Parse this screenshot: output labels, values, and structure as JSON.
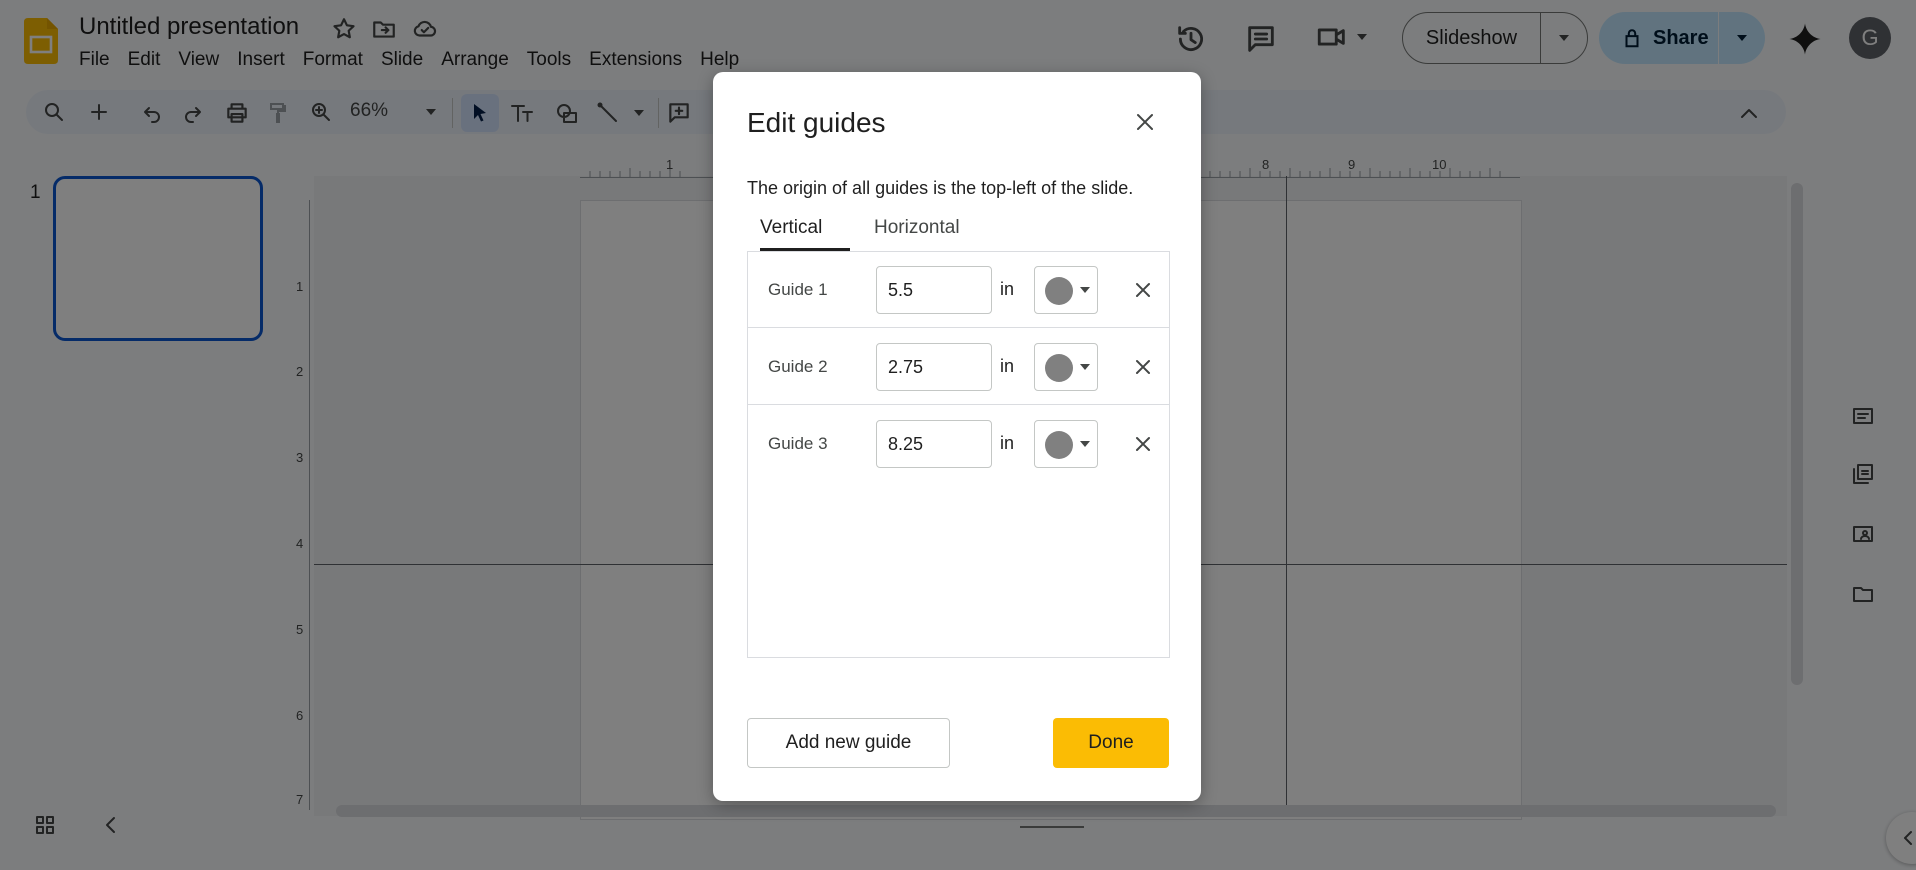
{
  "app": {
    "doc_title": "Untitled presentation",
    "menus": [
      "File",
      "Edit",
      "View",
      "Insert",
      "Format",
      "Slide",
      "Arrange",
      "Tools",
      "Extensions",
      "Help"
    ],
    "slideshow_label": "Slideshow",
    "share_label": "Share",
    "avatar_letter": "G",
    "zoom": "66%",
    "brand_color": "#fbbc04"
  },
  "filmstrip": {
    "slide_number": "1"
  },
  "rulers": {
    "top": [
      "1",
      "8",
      "9",
      "10"
    ],
    "left": [
      "1",
      "2",
      "3",
      "4",
      "5",
      "6",
      "7"
    ]
  },
  "dialog": {
    "title": "Edit guides",
    "description": "The origin of all guides is the top-left of the slide.",
    "tabs": {
      "vertical": "Vertical",
      "horizontal": "Horizontal",
      "active": "Vertical"
    },
    "unit": "in",
    "guides": [
      {
        "label": "Guide 1",
        "value": "5.5",
        "color": "#808080"
      },
      {
        "label": "Guide 2",
        "value": "2.75",
        "color": "#808080"
      },
      {
        "label": "Guide 3",
        "value": "8.25",
        "color": "#808080"
      }
    ],
    "add_button": "Add new guide",
    "done_button": "Done"
  }
}
